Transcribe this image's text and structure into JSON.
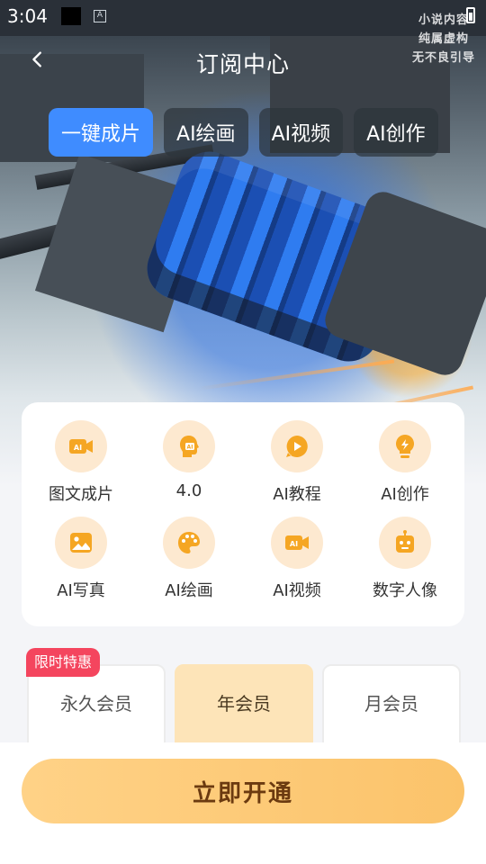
{
  "status_bar": {
    "time": "3:04",
    "a_badge": "A"
  },
  "watermark": {
    "line1": "小说内容",
    "line2": "纯属虚构",
    "line3": "无不良引导"
  },
  "header": {
    "title": "订阅中心"
  },
  "tabs": [
    {
      "label": "一键成片",
      "active": true
    },
    {
      "label": "AI绘画",
      "active": false
    },
    {
      "label": "AI视频",
      "active": false
    },
    {
      "label": "AI创作",
      "active": false
    }
  ],
  "features": [
    {
      "label": "图文成片",
      "icon": "video-camera-ai-icon"
    },
    {
      "label": "4.0",
      "icon": "ai-head-icon"
    },
    {
      "label": "AI教程",
      "icon": "play-bubble-icon"
    },
    {
      "label": "AI创作",
      "icon": "lightbulb-icon"
    },
    {
      "label": "AI写真",
      "icon": "photo-icon"
    },
    {
      "label": "AI绘画",
      "icon": "palette-icon"
    },
    {
      "label": "AI视频",
      "icon": "video-camera-ai-icon"
    },
    {
      "label": "数字人像",
      "icon": "robot-icon"
    }
  ],
  "icon_text": {
    "ai": "AI"
  },
  "plans": {
    "badge": "限时特惠",
    "items": [
      {
        "label": "永久会员",
        "selected": false
      },
      {
        "label": "年会员",
        "selected": true
      },
      {
        "label": "月会员",
        "selected": false
      }
    ]
  },
  "cta": {
    "label": "立即开通"
  },
  "colors": {
    "accent": "#3f8cff",
    "icon_bg": "#fde9d0",
    "icon_fg": "#f5a623",
    "badge": "#f4455e",
    "cta": "#fbc36a"
  }
}
